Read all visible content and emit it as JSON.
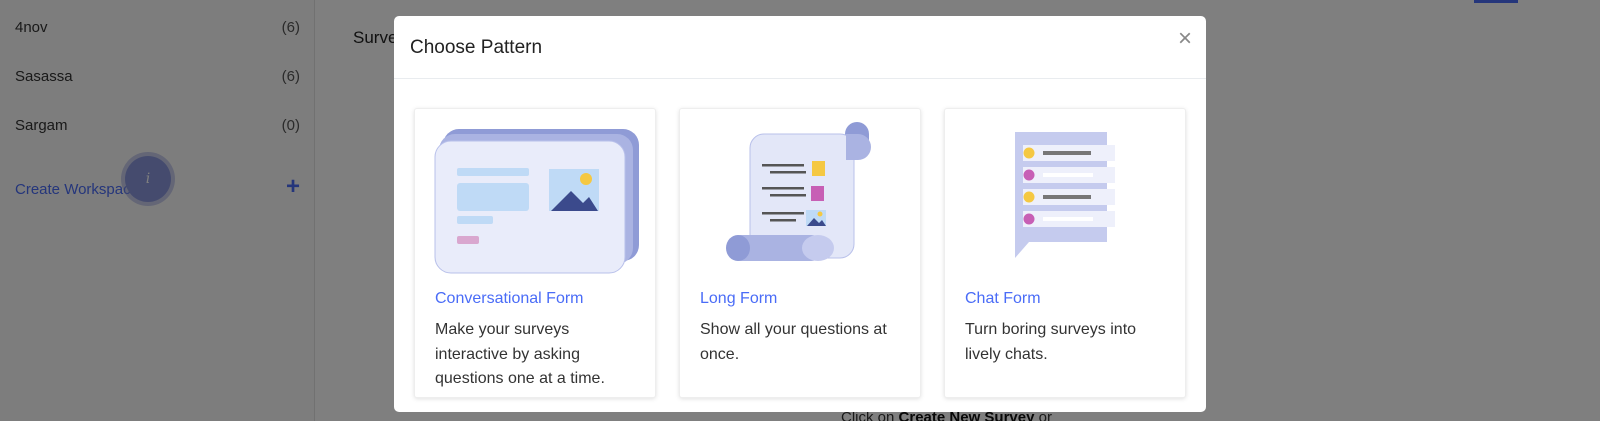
{
  "sidebar": {
    "workspaces": [
      {
        "name": "4nov",
        "count": "(6)"
      },
      {
        "name": "Sasassa",
        "count": "(6)"
      },
      {
        "name": "Sargam",
        "count": "(0)"
      }
    ],
    "create_workspace_label": "Create Workspace",
    "plus_glyph": "+",
    "info_glyph": "i"
  },
  "main": {
    "title": "Surveys",
    "hint_prefix": "Click on ",
    "hint_link": "Create New Survey",
    "hint_suffix": " or"
  },
  "modal": {
    "title": "Choose Pattern",
    "close_glyph": "×",
    "cards": [
      {
        "title": "Conversational Form",
        "description": "Make your surveys interactive by asking questions one at a time.",
        "icon": "conversational-form-illustration"
      },
      {
        "title": "Long Form",
        "description": "Show all your questions at once.",
        "icon": "long-form-scroll-illustration"
      },
      {
        "title": "Chat Form",
        "description": "Turn boring surveys into lively chats.",
        "icon": "chat-form-illustration"
      }
    ]
  },
  "colors": {
    "accent": "#4a6cf7",
    "illustration_primary": "#c5cbee",
    "illustration_dark": "#3b4a8c",
    "yellow": "#f5c842",
    "pink": "#c75fb5"
  }
}
